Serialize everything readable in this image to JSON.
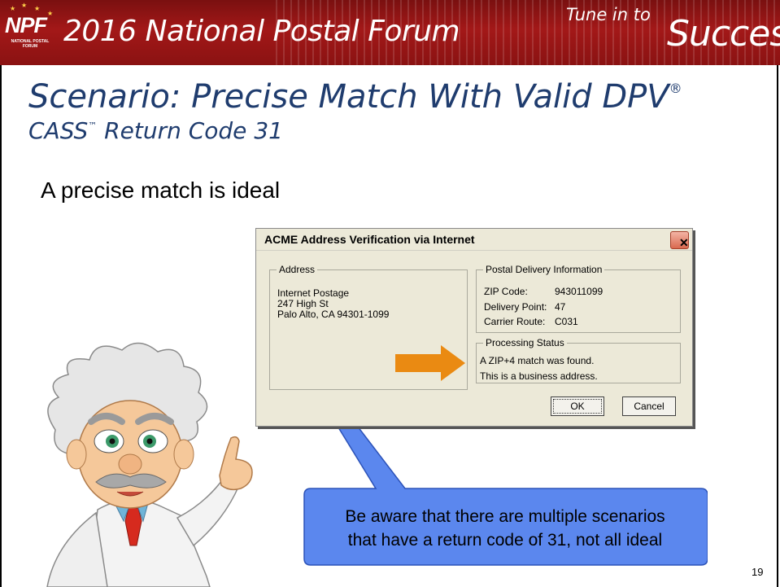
{
  "banner": {
    "logo_text": "NPF",
    "logo_subtext": "NATIONAL POSTAL FORUM",
    "event_title": "2016 National Postal Forum",
    "tagline_small": "Tune in to",
    "tagline_large": "Success"
  },
  "slide": {
    "title": "Scenario: Precise Match With Valid DPV",
    "title_mark": "®",
    "subtitle": "CASS",
    "subtitle_mark": "™",
    "subtitle_rest": " Return Code 31",
    "bullet": "A precise match is ideal",
    "page_number": "19"
  },
  "dialog": {
    "title": "ACME Address Verification via Internet",
    "close_glyph": "✕",
    "address": {
      "legend": "Address",
      "line1": "Internet Postage",
      "line2": "247 High St",
      "line3": "Palo Alto, CA 94301-1099"
    },
    "delivery": {
      "legend": "Postal Delivery Information",
      "zip_label": "ZIP Code:",
      "zip_value": "943011099",
      "dp_label": "Delivery Point:",
      "dp_value": "47",
      "cr_label": "Carrier Route:",
      "cr_value": "C031"
    },
    "status": {
      "legend": "Processing Status",
      "line1": "A ZIP+4 match was found.",
      "line2": "This is a business address."
    },
    "ok_label": "OK",
    "cancel_label": "Cancel"
  },
  "callout": {
    "line1": "Be aware that there are multiple scenarios",
    "line2": "that have a return code of 31, not all ideal"
  },
  "colors": {
    "banner": "#a31818",
    "title": "#1f3c6e",
    "arrow": "#ea8a12",
    "callout": "#5b87ee"
  }
}
